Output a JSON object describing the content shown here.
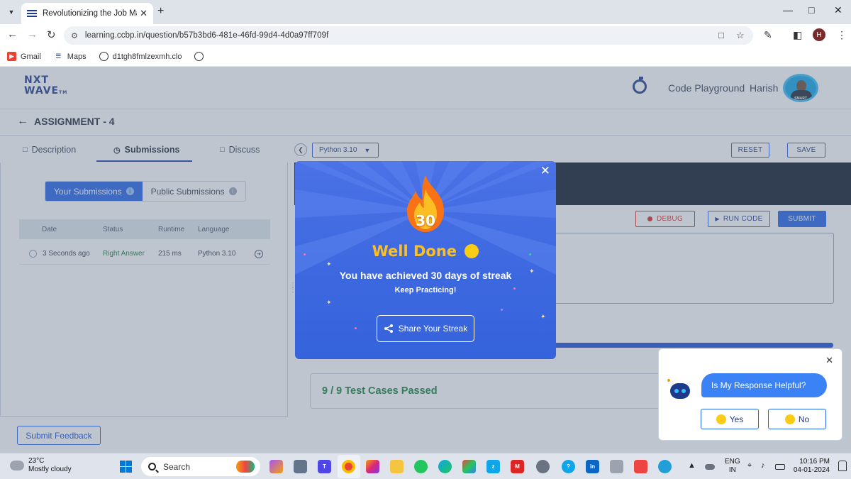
{
  "browser": {
    "tab_title": "Revolutionizing the Job Market",
    "url": "learning.ccbp.in/question/b57b3bd6-481e-46fd-99d4-4d0a97ff709f",
    "profile_initial": "H",
    "bookmarks": [
      "Gmail",
      "Maps",
      "d1tgh8fmlzexmh.clo"
    ]
  },
  "header": {
    "logo_line1": "NXT",
    "logo_line2": "WAVE",
    "logo_tm": "TM",
    "code_playground": "Code Playground",
    "user_name": "Harish",
    "avatar_badge": "SMART"
  },
  "assignment": {
    "title": "ASSIGNMENT - 4"
  },
  "tabs": [
    "Description",
    "Submissions",
    "Discuss"
  ],
  "submissions": {
    "your_label": "Your Submissions",
    "public_label": "Public Submissions",
    "columns": [
      "Date",
      "Status",
      "Runtime",
      "Language"
    ],
    "rows": [
      {
        "date": "3 Seconds ago",
        "status": "Right Answer",
        "runtime": "215 ms",
        "language": "Python 3.10"
      }
    ]
  },
  "submit_feedback": "Submit Feedback",
  "editor": {
    "language": "Python 3.10",
    "reset": "RESET",
    "save": "SAVE",
    "debug": "DEBUG",
    "run_code": "RUN CODE",
    "submit": "SUBMIT",
    "result": "9 / 9 Test Cases Passed"
  },
  "feedback_widget": {
    "question": "Is My Response Helpful?",
    "yes": "Yes",
    "no": "No"
  },
  "modal": {
    "streak_count": "30",
    "title": "Well Done",
    "message": "You have achieved 30 days of streak",
    "sub": "Keep Practicing!",
    "share": "Share Your Streak"
  },
  "taskbar": {
    "temperature": "23°C",
    "weather": "Mostly cloudy",
    "search": "Search",
    "lang1": "ENG",
    "lang2": "IN",
    "time": "10:16 PM",
    "date": "04-01-2024"
  },
  "colors": {
    "brand_blue": "#1e3a8a",
    "primary": "#2563eb",
    "success": "#15803d",
    "modal_bg": "#3e69e0",
    "well_done": "#fbbf24",
    "debug_red": "#dc2626"
  }
}
